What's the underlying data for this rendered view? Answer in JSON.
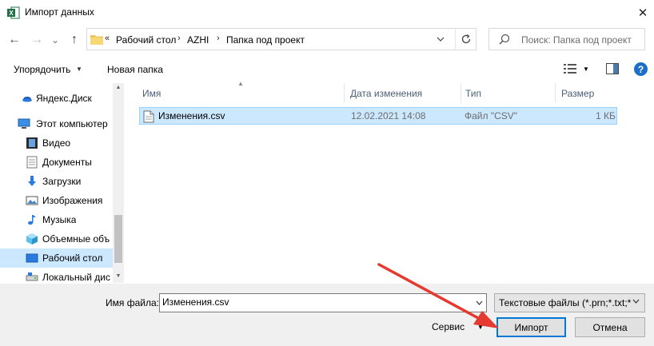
{
  "window": {
    "title": "Импорт данных",
    "close_glyph": "✕"
  },
  "nav": {
    "back_glyph": "←",
    "forward_glyph": "→",
    "recent_glyph": "⌄",
    "up_glyph": "↑"
  },
  "address": {
    "overflow": "«",
    "parts": [
      "Рабочий стол",
      "AZHI",
      "Папка под проект"
    ],
    "separator": "›"
  },
  "search": {
    "placeholder": "Поиск: Папка под проект"
  },
  "toolbar": {
    "organize_label": "Упорядочить",
    "new_folder_label": "Новая папка",
    "help_label": "?"
  },
  "navpane": {
    "items": [
      {
        "label": "Яндекс.Диск",
        "icon": "yandex-disk-icon",
        "selected": false
      },
      {
        "label": "Этот компьютер",
        "icon": "computer-icon",
        "selected": false
      },
      {
        "label": "Видео",
        "icon": "video-icon",
        "selected": false
      },
      {
        "label": "Документы",
        "icon": "documents-icon",
        "selected": false
      },
      {
        "label": "Загрузки",
        "icon": "downloads-icon",
        "selected": false
      },
      {
        "label": "Изображения",
        "icon": "pictures-icon",
        "selected": false
      },
      {
        "label": "Музыка",
        "icon": "music-icon",
        "selected": false
      },
      {
        "label": "Объемные объ",
        "icon": "3d-objects-icon",
        "selected": false
      },
      {
        "label": "Рабочий стол",
        "icon": "desktop-icon",
        "selected": true
      },
      {
        "label": "Локальный дис",
        "icon": "local-disk-icon",
        "selected": false
      }
    ]
  },
  "filelist": {
    "columns": [
      "Имя",
      "Дата изменения",
      "Тип",
      "Размер"
    ],
    "rows": [
      {
        "name": "Изменения.csv",
        "date": "12.02.2021 14:08",
        "type": "Файл \"CSV\"",
        "size": "1 КБ"
      }
    ]
  },
  "bottom": {
    "filename_label": "Имя файла:",
    "filename_value": "Изменения.csv",
    "filter_value": "Текстовые файлы (*.prn;*.txt;*",
    "service_label": "Сервис",
    "import_label": "Импорт",
    "cancel_label": "Отмена"
  },
  "colors": {
    "selection_bg": "#cce8ff",
    "selection_border": "#99d1ff",
    "accent": "#0078d7",
    "annotation_arrow": "#e53a2f",
    "excel_green": "#1e7145"
  }
}
